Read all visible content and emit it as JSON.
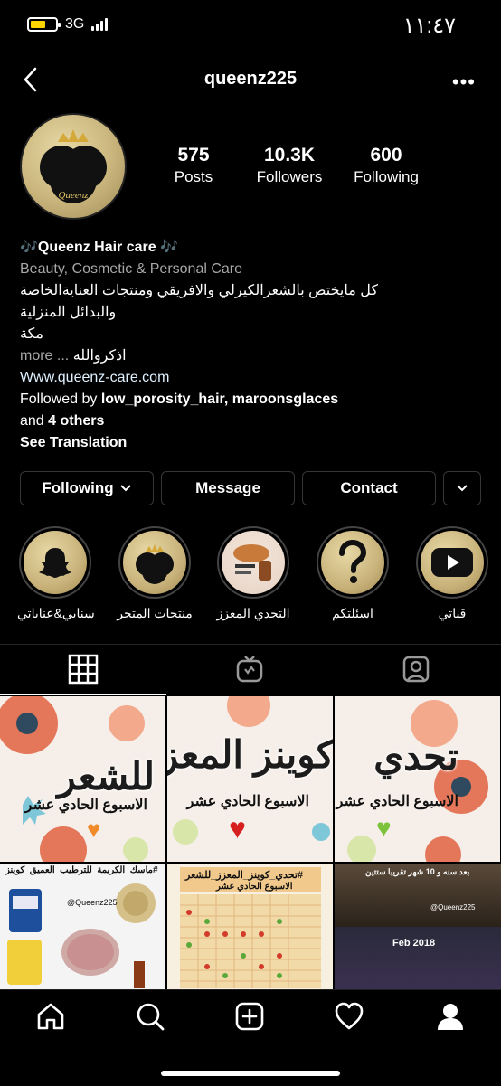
{
  "status": {
    "time": "١١:٤٧",
    "network": "3G"
  },
  "header": {
    "username": "queenz225"
  },
  "stats": [
    {
      "value": "575",
      "label": "Posts"
    },
    {
      "value": "10.3K",
      "label": "Followers"
    },
    {
      "value": "600",
      "label": "Following"
    }
  ],
  "bio": {
    "name": "🎶Queenz Hair care 🎶",
    "category": "Beauty, Cosmetic & Personal Care",
    "line1": "كل مايختص بالشعرالكيرلي والافريقي ومنتجات العنايةالخاصة",
    "line2": "والبدائل المنزلية",
    "line3": "مكة",
    "line4_text": "اذكروالله",
    "line4_more": "more ...",
    "website": "Www.queenz-care.com",
    "followed_prefix": "Followed by ",
    "followed_names": "low_porosity_hair, maroonsglaces",
    "followed_and": "and ",
    "followed_others": "4 others",
    "see_translation": "See Translation"
  },
  "buttons": {
    "following": "Following",
    "message": "Message",
    "contact": "Contact"
  },
  "highlights": [
    {
      "label": "سنابي&عناياتي",
      "icon": "snapchat-icon"
    },
    {
      "label": "منتجات المتجر",
      "icon": "queenz-logo"
    },
    {
      "label": "التحدي المعزز",
      "icon": "hair-oil-image"
    },
    {
      "label": "اسئلتكم",
      "icon": "question-icon"
    },
    {
      "label": "قناتي",
      "icon": "youtube-icon"
    }
  ],
  "posts": {
    "p1_title": "للشعر",
    "p2_title": "كوينز المعزز",
    "p3_title": "تحدي",
    "week_label": "الاسبوع الحادي عشر",
    "p4_caption": "#ماسك_الكريمة_للترطيب_العميق_كوينز",
    "p4_handle": "@Queenz225",
    "p5_caption": "#تحدي_كوينز_المعزز_للشعر",
    "p5_sub": "الاسبوع الحادي عشر",
    "p6_caption": "بعد سنه و 10 شهر تقريبا ستتين",
    "p6_handle": "@Queenz225",
    "p6_date": "Feb 2018"
  },
  "colors": {
    "accent_gold": "#c8b27a",
    "link": "#e0f1ff",
    "muted": "#a8a8a8"
  }
}
